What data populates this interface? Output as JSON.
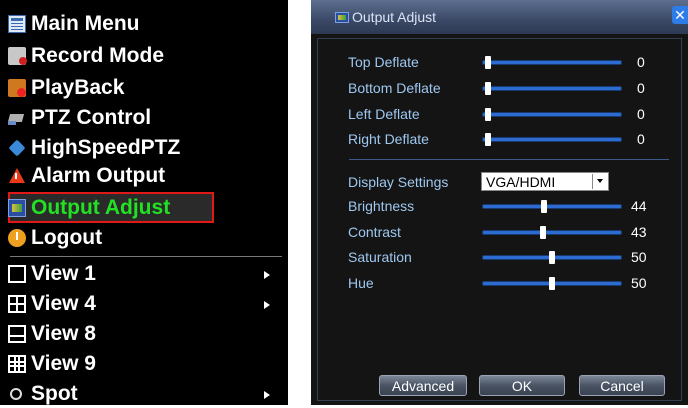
{
  "menu": {
    "items": [
      {
        "label": "Main Menu",
        "icon": "main-menu-icon"
      },
      {
        "label": "Record Mode",
        "icon": "record-icon"
      },
      {
        "label": "PlayBack",
        "icon": "playback-icon"
      },
      {
        "label": "PTZ Control",
        "icon": "ptz-camera-icon"
      },
      {
        "label": "HighSpeedPTZ",
        "icon": "highspeed-ptz-icon"
      },
      {
        "label": "Alarm Output",
        "icon": "alarm-icon"
      },
      {
        "label": "Output Adjust",
        "icon": "output-adjust-icon"
      },
      {
        "label": "Logout",
        "icon": "logout-icon"
      },
      {
        "label": "View 1",
        "icon": "view-1-icon"
      },
      {
        "label": "View 4",
        "icon": "view-4-icon"
      },
      {
        "label": "View 8",
        "icon": "view-8-icon"
      },
      {
        "label": "View 9",
        "icon": "view-9-icon"
      },
      {
        "label": "Spot",
        "icon": "spot-icon"
      }
    ],
    "highlight_color": "#e01818",
    "active_text_color": "#22e022"
  },
  "dialog": {
    "title": "Output Adjust",
    "deflate": [
      {
        "label": "Top Deflate",
        "value": "0",
        "level": 0
      },
      {
        "label": "Bottom Deflate",
        "value": "0",
        "level": 0
      },
      {
        "label": "Left Deflate",
        "value": "0",
        "level": 0
      },
      {
        "label": "Right Deflate",
        "value": "0",
        "level": 0
      }
    ],
    "display_settings": {
      "label": "Display Settings",
      "value": "VGA/HDMI"
    },
    "image": [
      {
        "label": "Brightness",
        "value": "44",
        "level": 0.44
      },
      {
        "label": "Contrast",
        "value": "43",
        "level": 0.43
      },
      {
        "label": "Saturation",
        "value": "50",
        "level": 0.5
      },
      {
        "label": "Hue",
        "value": "50",
        "level": 0.5
      }
    ],
    "buttons": {
      "advanced": "Advanced",
      "ok": "OK",
      "cancel": "Cancel"
    },
    "accent_color": "#2c6cd0",
    "label_color": "#9ec8f0"
  }
}
